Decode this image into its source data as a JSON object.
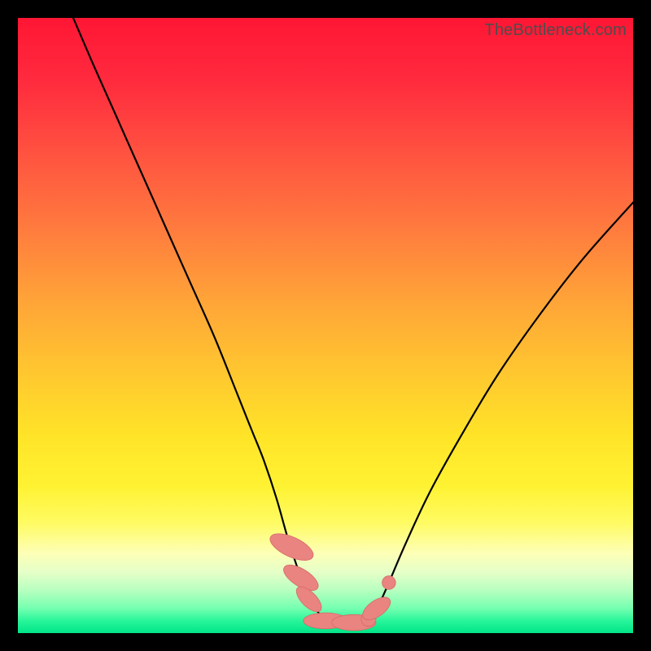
{
  "watermark": "TheBottleneck.com",
  "colors": {
    "background": "#000000",
    "gradient_top": "#ff1634",
    "gradient_bottom": "#00e688",
    "curve": "#000000",
    "marker_fill": "#e98480",
    "marker_stroke": "#d66b68"
  },
  "chart_data": {
    "type": "line",
    "title": "",
    "xlabel": "",
    "ylabel": "",
    "xlim": [
      0,
      100
    ],
    "ylim": [
      0,
      100
    ],
    "series": [
      {
        "name": "bottleneck-curve",
        "x": [
          9,
          12,
          16,
          20,
          24,
          28,
          32,
          36,
          38,
          40,
          42,
          44,
          46,
          47,
          48,
          50,
          52,
          54,
          56,
          57,
          58,
          60,
          63,
          67,
          72,
          78,
          85,
          92,
          100
        ],
        "y": [
          100,
          93,
          84,
          75,
          66,
          57,
          48,
          38,
          33,
          28,
          22,
          15,
          9,
          6.5,
          4.5,
          2.1,
          1.6,
          1.5,
          1.5,
          2.0,
          3.2,
          7.5,
          14.5,
          23,
          32,
          42,
          52,
          61,
          70
        ]
      }
    ],
    "markers": [
      {
        "cx": 44.5,
        "cy": 14.0,
        "rx": 1.6,
        "ry": 3.8,
        "angle": -65
      },
      {
        "cx": 46.0,
        "cy": 9.0,
        "rx": 1.4,
        "ry": 3.2,
        "angle": -58
      },
      {
        "cx": 47.3,
        "cy": 5.5,
        "rx": 1.2,
        "ry": 2.6,
        "angle": -45
      },
      {
        "cx": 50.0,
        "cy": 2.0,
        "rx": 3.6,
        "ry": 1.3,
        "angle": 0
      },
      {
        "cx": 54.6,
        "cy": 1.7,
        "rx": 3.6,
        "ry": 1.3,
        "angle": 0
      },
      {
        "cx": 57.0,
        "cy": 2.3,
        "rx": 1.2,
        "ry": 1.2,
        "angle": 0
      },
      {
        "cx": 58.3,
        "cy": 4.0,
        "rx": 1.3,
        "ry": 2.6,
        "angle": 55
      },
      {
        "cx": 60.3,
        "cy": 8.2,
        "rx": 1.1,
        "ry": 1.1,
        "angle": 0
      }
    ]
  }
}
